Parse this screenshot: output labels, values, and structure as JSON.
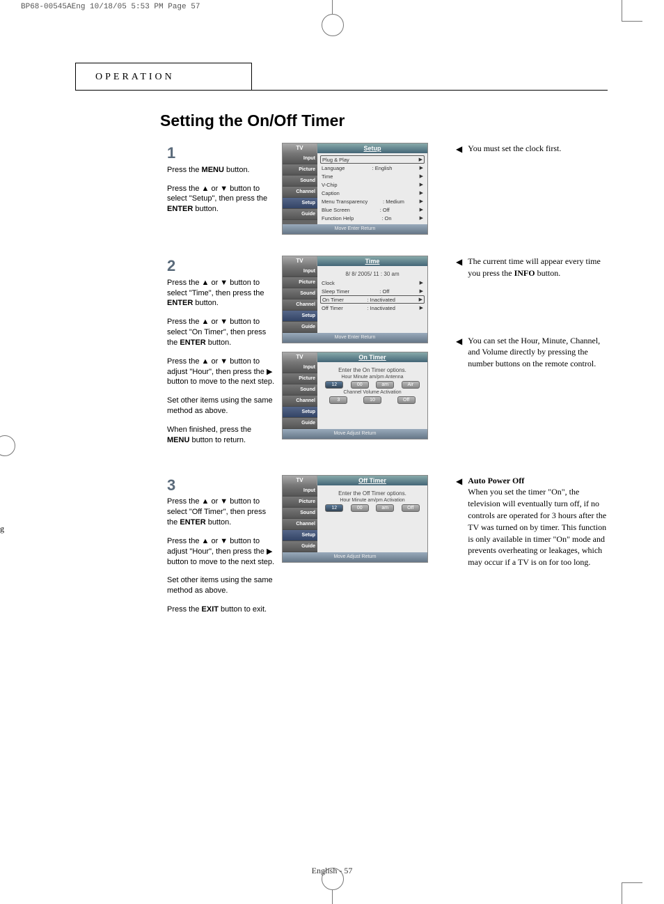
{
  "print_header": "BP68-00545AEng  10/18/05  5:53 PM  Page 57",
  "section": "OPERATION",
  "title": "Setting the On/Off Timer",
  "stray": "g",
  "step1": {
    "num": "1",
    "p1a": "Press the ",
    "p1b": "MENU",
    "p1c": " button.",
    "p2a": "Press the  ▲ or ▼  button to select \"Setup\", then press the ",
    "p2b": "ENTER",
    "p2c": " button."
  },
  "step2": {
    "num": "2",
    "p1a": "Press the  ▲ or ▼ button to select \"Time\", then press the ",
    "p1b": "ENTER",
    "p1c": " button.",
    "p2a": "Press the ▲ or ▼ button to select \"On Timer\", then press the ",
    "p2b": "ENTER",
    "p2c": " button.",
    "p3": "Press the ▲ or ▼ button to adjust \"Hour\", then press the ▶ button to move to the next step.",
    "p4": "Set other items using the same method as above.",
    "p5a": "When finished, press the ",
    "p5b": "MENU",
    "p5c": " button to return."
  },
  "step3": {
    "num": "3",
    "p1a": "Press the ▲ or ▼ button to select \"Off Timer\", then press the ",
    "p1b": "ENTER",
    "p1c": " button.",
    "p2": "Press the ▲ or ▼ button to adjust \"Hour\", then press the ▶ button to move to the next step.",
    "p3": "Set other items using the same method as above.",
    "p4a": "Press the ",
    "p4b": "EXIT",
    "p4c": " button to exit."
  },
  "note1": "You must set the clock first.",
  "note2a": "The current time will appear every time you press the ",
  "note2b": "INFO",
  "note2c": " button.",
  "note3": "You can set the Hour, Minute, Channel, and Volume directly by pressing the number buttons on the remote control.",
  "note4title": "Auto Power Off",
  "note4body": "When you set the timer \"On\", the television will eventually turn off, if no controls are operated for 3 hours after the TV was turned on by timer. This function is only available in timer \"On\" mode and prevents overheating or leakages, which may occur if a TV is on for too long.",
  "osd": {
    "tv": "TV",
    "side": {
      "input": "Input",
      "picture": "Picture",
      "sound": "Sound",
      "channel": "Channel",
      "setup": "Setup",
      "guide": "Guide"
    },
    "setup": {
      "title": "Setup",
      "r1": "Plug & Play",
      "r2": "Language",
      "r2v": ": English",
      "r3": "Time",
      "r4": "V-Chip",
      "r5": "Caption",
      "r6": "Menu Transparency",
      "r6v": ": Medium",
      "r7": "Blue Screen",
      "r7v": ": Off",
      "r8": "Function Help",
      "r8v": ": On",
      "footer": "Move        Enter       Return"
    },
    "time": {
      "title": "Time",
      "datetime": "8/ 8/ 2005/ 11 : 30 am",
      "r1": "Clock",
      "r2": "Sleep Timer",
      "r2v": ": Off",
      "r3": "On Timer",
      "r3v": ": Inactivated",
      "r4": "Off Timer",
      "r4v": ": Inactivated",
      "footer": "Move        Enter       Return"
    },
    "ontimer": {
      "title": "On Timer",
      "prompt": "Enter the On Timer options.",
      "head1": "Hour    Minute  am/pm  Antenna",
      "v1": "12",
      "v2": "00",
      "v3": "am",
      "v4": "Air",
      "head2": "Channel      Volume Activation",
      "v5": "3",
      "v6": "10",
      "v7": "Off",
      "footer": "Move       Adjust       Return"
    },
    "offtimer": {
      "title": "Off Timer",
      "prompt": "Enter the Off  Timer options.",
      "head1": "Hour    Minute  am/pm Activation",
      "v1": "12",
      "v2": "00",
      "v3": "am",
      "v4": "Off",
      "footer": "Move       Adjust       Return"
    }
  },
  "pagenum": "English - 57"
}
